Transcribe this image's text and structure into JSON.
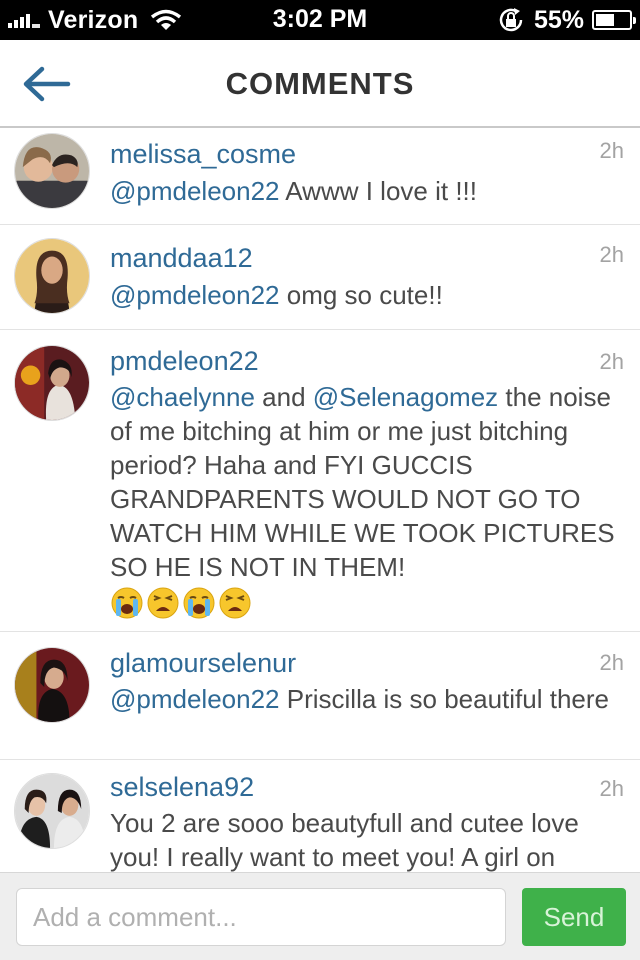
{
  "status_bar": {
    "carrier": "Verizon",
    "time": "3:02 PM",
    "battery": "55%",
    "battery_level": 0.55,
    "icons": [
      "signal-icon",
      "wifi-icon",
      "rotation-lock-icon",
      "battery-icon"
    ]
  },
  "header": {
    "title": "COMMENTS",
    "back_icon": "back-arrow-icon",
    "accent_color": "#2f6a96"
  },
  "comments": [
    {
      "username": "melissa_cosme",
      "time": "2h",
      "mention": "@pmdeleon22",
      "text": " Awww I love it !!!"
    },
    {
      "username": "manddaa12",
      "time": "2h",
      "mention": "@pmdeleon22",
      "text": " omg so cute!!"
    },
    {
      "username": "pmdeleon22",
      "time": "2h",
      "mention": "@chaelynne",
      "and_text": " and ",
      "mention2": "@Selenagomez",
      "text": " the noise of me bitching at him or me just bitching period? Haha and FYI GUCCIS GRANDPARENTS WOULD NOT GO TO WATCH HIM WHILE WE TOOK PICTURES SO HE IS NOT IN THEM!",
      "emojis": [
        "crying-face-emoji",
        "weary-face-emoji",
        "crying-face-emoji",
        "weary-face-emoji"
      ]
    },
    {
      "username": "glamourselenur",
      "time": "2h",
      "mention": "@pmdeleon22",
      "text": " Priscilla is so beautiful there"
    },
    {
      "username": "selselena92",
      "time": "2h",
      "text": "You 2 are sooo beautyfull and cutee love you! I really want to meet you! A girl on"
    }
  ],
  "input_bar": {
    "placeholder": "Add a comment...",
    "send_label": "Send",
    "send_color": "#3fb14a"
  }
}
